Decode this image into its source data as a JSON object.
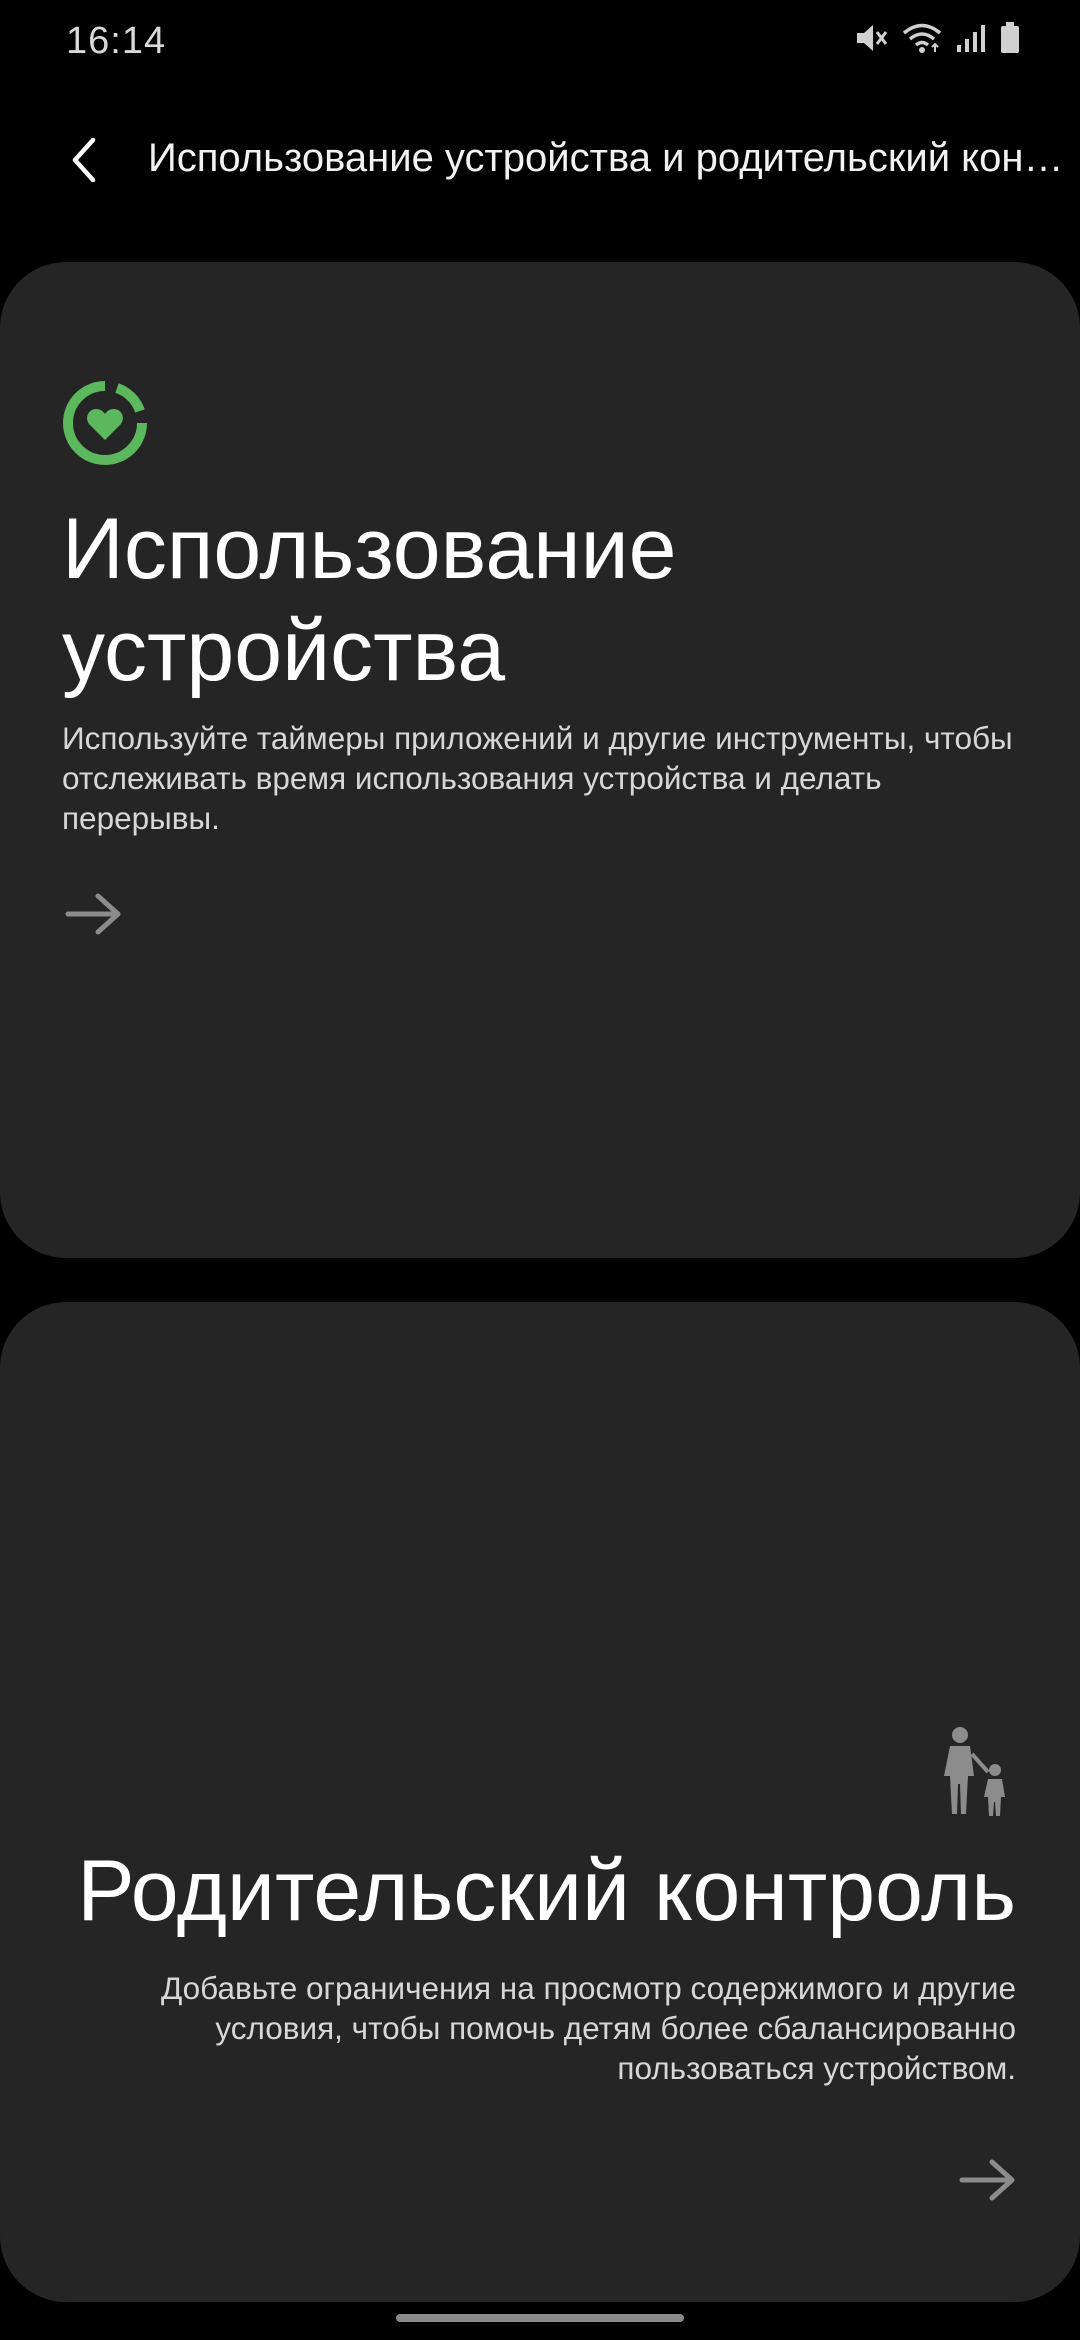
{
  "status_bar": {
    "time": "16:14",
    "icons": [
      "mute-icon",
      "wifi-icon",
      "signal-icon",
      "battery-icon"
    ]
  },
  "header": {
    "back_icon": "chevron-left-icon",
    "title": "Использование устройства и родительский контроль"
  },
  "cards": {
    "usage": {
      "icon": "digital-wellbeing-heart-icon",
      "title": "Использование\nустройства",
      "description": "Используйте таймеры приложений и другие инструменты, чтобы отслеживать время использования устройства и делать перерывы.",
      "arrow_icon": "arrow-right-icon"
    },
    "parental": {
      "icon": "parent-child-icon",
      "title": "Родительский контроль",
      "description": "Добавьте ограничения на просмотр содержимого и другие условия, чтобы помочь детям более сбалансированно пользоваться устройством.",
      "arrow_icon": "arrow-right-icon"
    }
  },
  "colors": {
    "background": "#000000",
    "card": "#252525",
    "accent_green": "#5cb85c",
    "muted_icon": "#8c8c8c"
  }
}
